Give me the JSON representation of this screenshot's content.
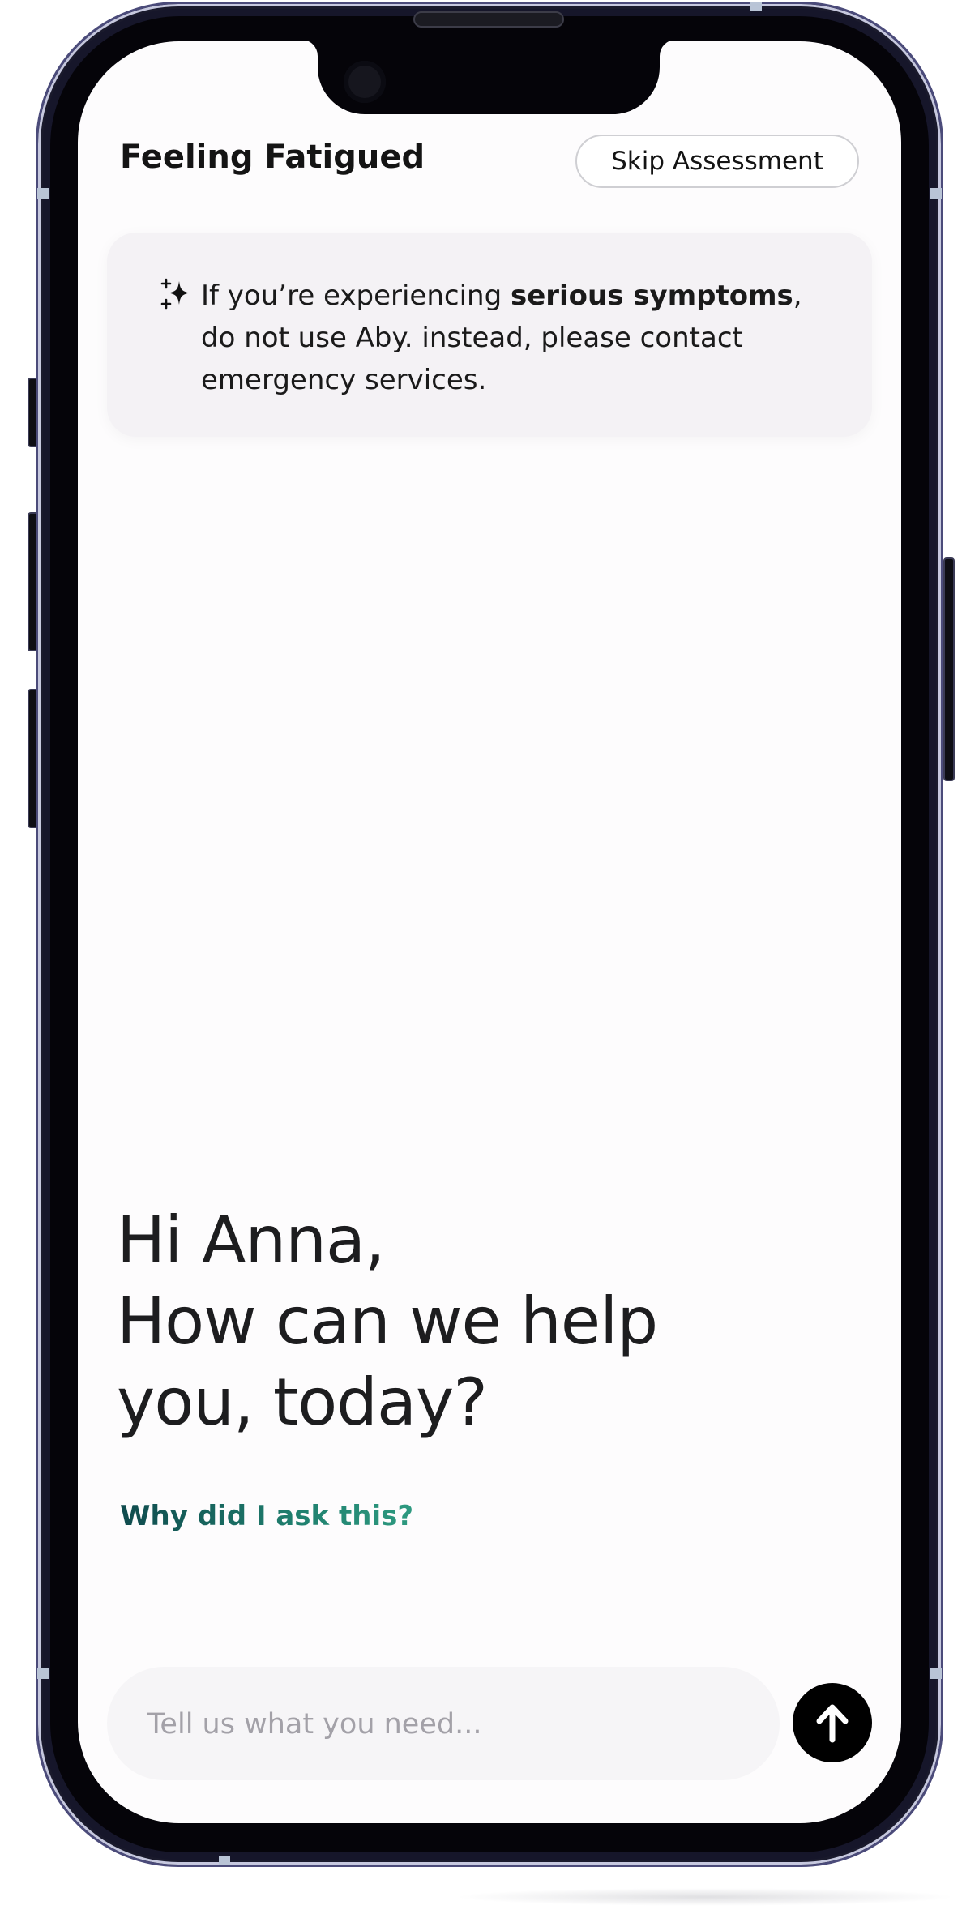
{
  "header": {
    "title": "Feeling Fatigued",
    "skip_label": "Skip Assessment"
  },
  "warning": {
    "icon": "sparkles-icon",
    "text_before": "If you’re experiencing ",
    "text_bold": "serious symptoms",
    "text_after": ", do not use Aby. instead, please contact emergency services."
  },
  "greeting": {
    "line1": "Hi Anna,",
    "line2": "How can we help",
    "line3": "you, today?"
  },
  "why_link": "Why did I ask this?",
  "composer": {
    "placeholder": "Tell us what you need...",
    "send_icon": "arrow-up-icon"
  },
  "colors": {
    "accent_dark": "#0f4a4d",
    "accent_light": "#2e9a80",
    "warning_bg": "#f4f2f5",
    "send_button": "#000000"
  }
}
